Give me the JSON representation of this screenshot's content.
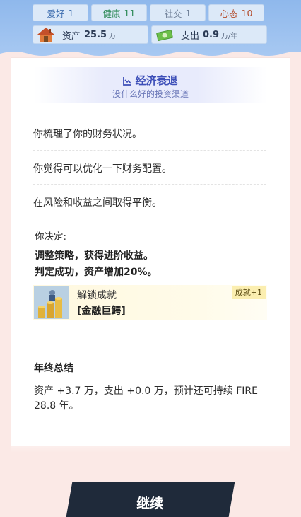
{
  "stats": {
    "love": {
      "label": "爱好",
      "value": "1"
    },
    "health": {
      "label": "健康",
      "value": "11"
    },
    "social": {
      "label": "社交",
      "value": "1"
    },
    "mood": {
      "label": "心态",
      "value": "10"
    },
    "assets": {
      "label": "资产",
      "value": "25.5",
      "unit": "万",
      "icon": "house-icon"
    },
    "expense": {
      "label": "支出",
      "value": "0.9",
      "unit": "万/年",
      "icon": "cash-icon"
    }
  },
  "event": {
    "title": "经济衰退",
    "subtitle": "没什么好的投资渠道",
    "icon": "chart-icon",
    "paragraphs": [
      "你梳理了你的财务状况。",
      "你觉得可以优化一下财务配置。",
      "在风险和收益之间取得平衡。"
    ]
  },
  "decision": {
    "label": "你决定:",
    "choice": "调整策略，获得进阶收益。",
    "result": "判定成功，资产增加20%。"
  },
  "achievement": {
    "unlock_label": "解锁成就",
    "name": "[金融巨鳄]",
    "badge": "成就+1",
    "icon": "gold-coins-icon"
  },
  "summary": {
    "title": "年终总结",
    "text": "资产 +3.7 万，支出 +0.0 万，预计还可持续 FIRE 28.8 年。"
  },
  "continue_label": "继续",
  "colors": {
    "panel": "#a8c9f2",
    "event_title": "#3d4fb8",
    "button": "#1f2a3a",
    "background": "#fbe9e6"
  }
}
